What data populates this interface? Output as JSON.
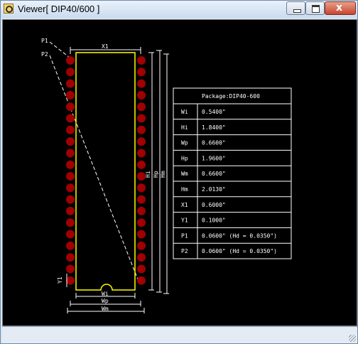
{
  "window": {
    "title": "Viewer[ DIP40/600 ]",
    "controls": {
      "minimize": "minimize",
      "maximize": "maximize",
      "close": "x"
    }
  },
  "drawing": {
    "pin_labels": {
      "p1": "P1",
      "p2": "P2"
    },
    "dim_labels": {
      "x1": "X1",
      "y1": "Y1",
      "wi": "Wi",
      "wp": "Wp",
      "wm": "Wm",
      "hi": "Hi",
      "hp": "Hp",
      "hm": "Hm"
    },
    "pins_per_side": 20,
    "colors": {
      "body_outline": "#ffff00",
      "pad": "#a00000",
      "dim_line": "#ffffff",
      "background": "#000000"
    }
  },
  "table": {
    "header": "Package:DIP40-600",
    "rows": [
      {
        "key": "Wi",
        "value": "0.5400\""
      },
      {
        "key": "Hi",
        "value": "1.8400\""
      },
      {
        "key": "Wp",
        "value": "0.6600\""
      },
      {
        "key": "Hp",
        "value": "1.9600\""
      },
      {
        "key": "Wm",
        "value": "0.6600\""
      },
      {
        "key": "Hm",
        "value": "2.0130\""
      },
      {
        "key": "X1",
        "value": "0.6000\""
      },
      {
        "key": "Y1",
        "value": "0.1000\""
      },
      {
        "key": "P1",
        "value": "0.0600\" (Hd = 0.0350\")"
      },
      {
        "key": "P2",
        "value": "0.0600\" (Hd = 0.0350\")"
      }
    ]
  }
}
